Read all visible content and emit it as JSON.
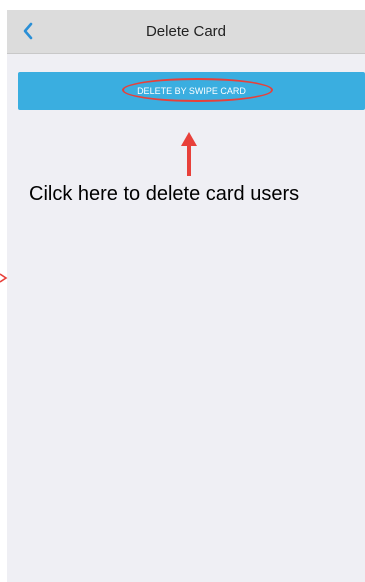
{
  "header": {
    "title": "Delete Card",
    "back_icon": "chevron-left-icon"
  },
  "main": {
    "delete_button_label": "DELETE BY SWIPE CARD"
  },
  "annotation": {
    "instruction_text": "Cilck here to delete card users",
    "arrow_icon": "arrow-up-icon"
  },
  "colors": {
    "accent": "#3aaee0",
    "annotation_red": "#e8403a",
    "nav_background": "#dcdcdc",
    "page_background": "#efeff4"
  }
}
